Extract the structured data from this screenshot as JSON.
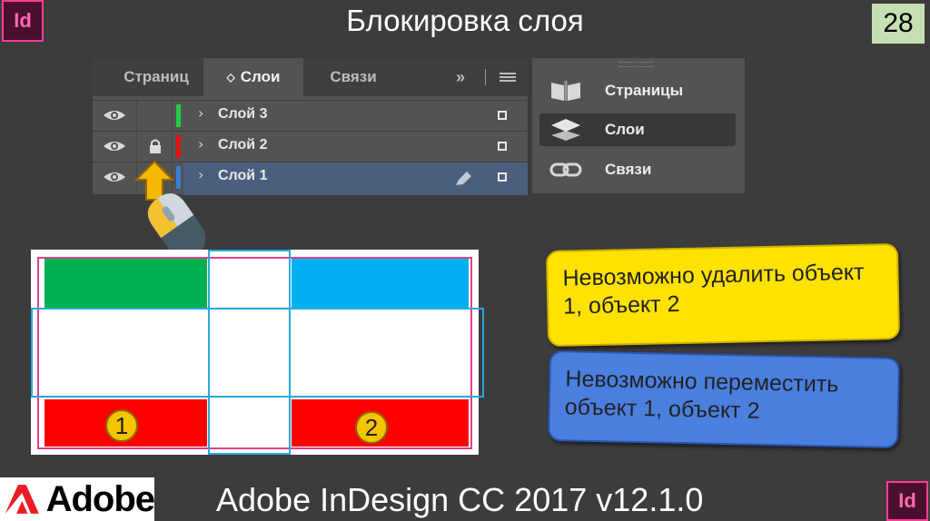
{
  "slide": {
    "title": "Блокировка слоя",
    "page_number": "28",
    "app_badge": "Id",
    "footer_text": "Adobe InDesign CC 2017 v12.1.0",
    "footer_logo": "Adobe"
  },
  "layers_panel": {
    "tabs": [
      {
        "label": "Страниц",
        "active": false
      },
      {
        "label": "Слои",
        "active": true
      },
      {
        "label": "Связи",
        "active": false
      }
    ],
    "expand_label": "»",
    "layers": [
      {
        "name": "Слой 3",
        "color": "#22cc44",
        "locked": false,
        "selected": false
      },
      {
        "name": "Слой 2",
        "color": "#e01010",
        "locked": true,
        "selected": false
      },
      {
        "name": "Слой 1",
        "color": "#3a7fd8",
        "locked": false,
        "selected": true
      }
    ]
  },
  "side_panel": {
    "items": [
      {
        "label": "Страницы",
        "icon": "pages-icon",
        "selected": false
      },
      {
        "label": "Слои",
        "icon": "layers-icon",
        "selected": true
      },
      {
        "label": "Связи",
        "icon": "links-icon",
        "selected": false
      }
    ]
  },
  "canvas": {
    "object_labels": [
      "1",
      "2"
    ],
    "colors": {
      "green": "#00b050",
      "cyan": "#00b0f0",
      "red": "#ff0000",
      "guide": "#29a8e0",
      "margin": "#e0408a"
    }
  },
  "callouts": [
    {
      "text": "Невозможно удалить объект 1, объект 2",
      "color": "#ffe200"
    },
    {
      "text": "Невозможно переместить объект 1, объект 2",
      "color": "#4a7fe0"
    }
  ]
}
